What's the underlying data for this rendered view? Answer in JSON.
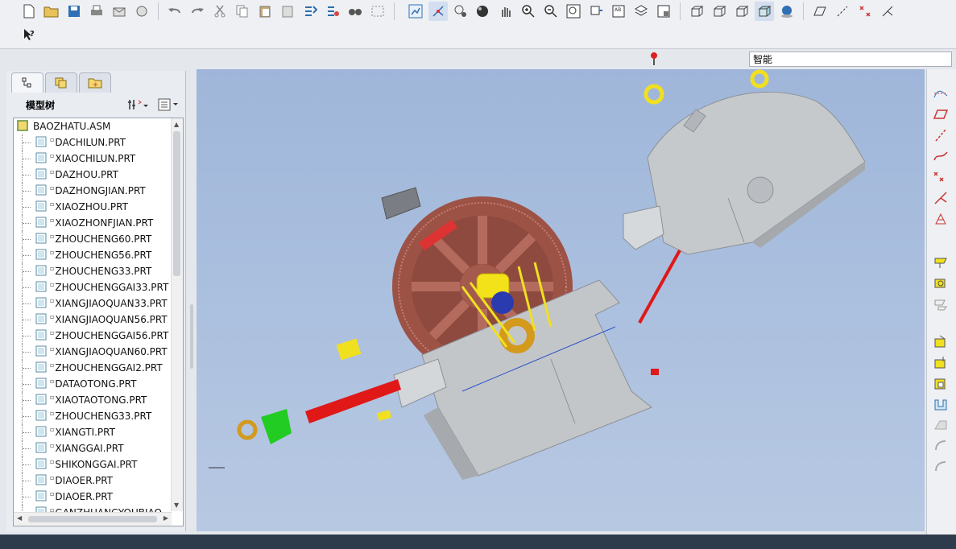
{
  "toolbar": {
    "smart_filter": "智能",
    "help_tip": "?"
  },
  "panel": {
    "title": "模型树",
    "tabs": [
      "model-tree",
      "layer-tree",
      "favorites"
    ]
  },
  "model_tree": {
    "root": "BAOZHATU.ASM",
    "items": [
      "DACHILUN.PRT",
      "XIAOCHILUN.PRT",
      "DAZHOU.PRT",
      "DAZHONGJIAN.PRT",
      "XIAOZHOU.PRT",
      "XIAOZHONFJIAN.PRT",
      "ZHOUCHENG60.PRT",
      "ZHOUCHENG56.PRT",
      "ZHOUCHENG33.PRT",
      "ZHOUCHENGGAI33.PRT",
      "XIANGJIAOQUAN33.PRT",
      "XIANGJIAOQUAN56.PRT",
      "ZHOUCHENGGAI56.PRT",
      "XIANGJIAOQUAN60.PRT",
      "ZHOUCHENGGAI2.PRT",
      "DATAOTONG.PRT",
      "XIAOTAOTONG.PRT",
      "ZHOUCHENG33.PRT",
      "XIANGTI.PRT",
      "XIANGGAI.PRT",
      "SHIKONGGAI.PRT",
      "DIAOER.PRT",
      "DIAOER.PRT",
      "GANZHUANGYOUBIAO"
    ]
  },
  "colors": {
    "viewport_top": "#9fb6da",
    "viewport_bottom": "#b7c8e2",
    "gear": "#a0564a",
    "housing": "#c9cccf",
    "shaft": "#e01818",
    "ring": "#d8a020",
    "bearing": "#f0e020",
    "pinion": "#22cc22"
  }
}
